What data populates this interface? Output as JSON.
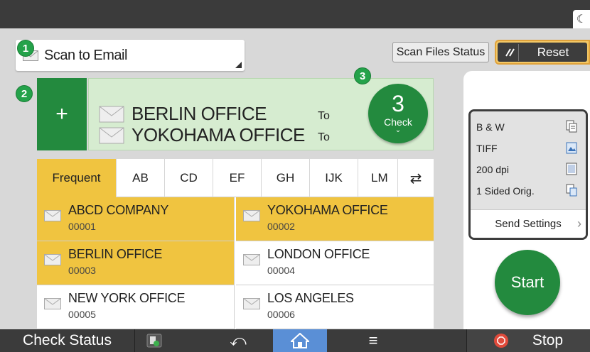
{
  "mode": {
    "label": "Scan to Email"
  },
  "badges": {
    "one": "1",
    "two": "2",
    "three": "3"
  },
  "header": {
    "scan_files_status": "Scan Files Status",
    "reset": "Reset"
  },
  "add_button": {
    "label": "+"
  },
  "destinations": [
    {
      "name": "BERLIN OFFICE",
      "field": "To"
    },
    {
      "name": "YOKOHAMA OFFICE",
      "field": "To"
    }
  ],
  "check": {
    "count": "3",
    "label": "Check"
  },
  "tabs": [
    "Frequent",
    "AB",
    "CD",
    "EF",
    "GH",
    "IJK",
    "LM"
  ],
  "entries": [
    {
      "name": "ABCD COMPANY",
      "number": "00001",
      "selected": true
    },
    {
      "name": "YOKOHAMA OFFICE",
      "number": "00002",
      "selected": true
    },
    {
      "name": "BERLIN OFFICE",
      "number": "00003",
      "selected": true
    },
    {
      "name": "LONDON OFFICE",
      "number": "00004",
      "selected": false
    },
    {
      "name": "NEW YORK OFFICE",
      "number": "00005",
      "selected": false
    },
    {
      "name": "LOS ANGELES",
      "number": "00006",
      "selected": false
    }
  ],
  "settings": {
    "color_mode": "B & W",
    "file_type": "TIFF",
    "resolution": "200 dpi",
    "original": "1 Sided Orig.",
    "send_settings": "Send Settings"
  },
  "start": {
    "label": "Start"
  },
  "bottom": {
    "check_status": "Check Status",
    "stop": "Stop"
  },
  "colors": {
    "green": "#238a3e",
    "yellow": "#f0c440",
    "home_blue": "#5a8fd6",
    "stop_red": "#e04a3b"
  },
  "icons": [
    "moon-icon",
    "envelope-icon",
    "reset-icon",
    "swap-icon",
    "back-icon",
    "home-icon",
    "menu-icon",
    "stop-icon"
  ]
}
